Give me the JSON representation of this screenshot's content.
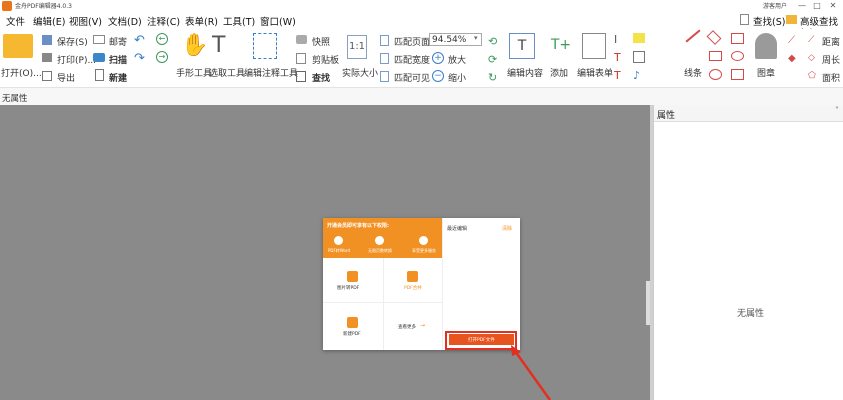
{
  "window": {
    "title": "金舟PDF编辑器4.0.3",
    "user_label": "游客用户",
    "minimize": "—",
    "maximize": "□",
    "close": "✕"
  },
  "menu": {
    "items": [
      "文件",
      "编辑(E)",
      "视图(V)",
      "文档(D)",
      "注释(C)",
      "表单(R)",
      "工具(T)",
      "窗口(W)"
    ],
    "find": "查找(S)",
    "advanced_find": "高级查找(S)"
  },
  "ribbon": {
    "open": "打开(O)...",
    "save": "保存(S)",
    "print": "打印(P)...",
    "export": "导出",
    "mail": "邮寄",
    "scan": "扫描",
    "new": "新建",
    "hand_tool": "手形工具",
    "select_tool": "选取工具",
    "edit_annot": "编辑注释工具",
    "snapshot": "快照",
    "clipboard": "剪贴板",
    "find": "查找",
    "actual_size": "实际大小",
    "fit_page": "匹配页面",
    "fit_width": "匹配宽度",
    "fit_visible": "匹配可见",
    "zoom_value": "94.54%",
    "zoom_in": "放大",
    "zoom_out": "缩小",
    "edit_content": "编辑内容",
    "add": "添加",
    "edit_form": "编辑表单",
    "lines": "线条",
    "stamp": "图章",
    "distance": "距离",
    "perimeter": "周长",
    "area": "面积"
  },
  "properties_strip": {
    "label": "无属性"
  },
  "panel": {
    "title": "属性",
    "empty": "无属性"
  },
  "dialog": {
    "promo": "开通会员即可享有以下权限:",
    "features": [
      "PDF转Word",
      "无限页数转换",
      "享受更多服务"
    ],
    "recent_title": "最近编辑",
    "clear": "清除",
    "tiles": {
      "img_to_pdf": "图片转PDF",
      "pdf_merge": "PDF合并",
      "new_pdf": "新建PDF",
      "see_more": "查看更多"
    },
    "open_button": "打开PDF文件"
  },
  "colors": {
    "accent": "#f29123",
    "canvas": "#8a8a8a",
    "highlight_red": "#e23020"
  }
}
